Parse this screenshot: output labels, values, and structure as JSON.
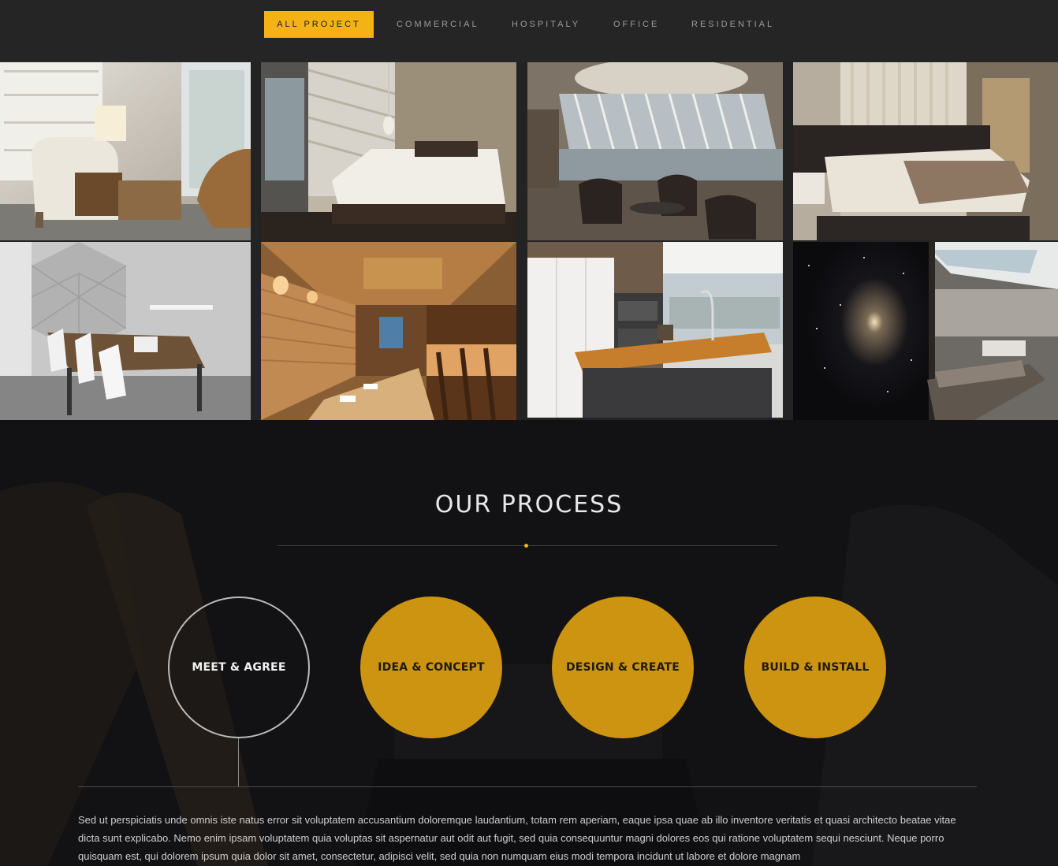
{
  "filters": {
    "items": [
      {
        "label": "ALL PROJECT",
        "active": true
      },
      {
        "label": "COMMERCIAL",
        "active": false
      },
      {
        "label": "HOSPITALY",
        "active": false
      },
      {
        "label": "OFFICE",
        "active": false
      },
      {
        "label": "RESIDENTIAL",
        "active": false
      }
    ]
  },
  "gallery": {
    "images": [
      "living-room-chairs-image",
      "bedroom-pendant-image",
      "lounge-panoramic-window-image",
      "modern-bedroom-image",
      "meeting-room-image",
      "restaurant-bar-image",
      "kitchen-island-image",
      "galaxy-wall-lounge-image"
    ]
  },
  "process": {
    "title": "OUR PROCESS",
    "steps": [
      {
        "label": "MEET & AGREE",
        "style": "outline"
      },
      {
        "label": "IDEA & CONCEPT",
        "style": "gold"
      },
      {
        "label": "DESIGN & CREATE",
        "style": "gold"
      },
      {
        "label": "BUILD & INSTALL",
        "style": "gold"
      }
    ],
    "description": "Sed ut perspiciatis unde omnis iste natus error sit voluptatem accusantium doloremque laudantium, totam rem aperiam, eaque ipsa quae ab illo inventore veritatis et quasi architecto beatae vitae dicta sunt explicabo. Nemo enim ipsam voluptatem quia voluptas sit aspernatur aut odit aut fugit, sed quia consequuntur magni dolores eos qui ratione voluptatem sequi nesciunt. Neque porro quisquam est, qui dolorem ipsum quia dolor sit amet, consectetur, adipisci velit, sed quia non numquam eius modi tempora incidunt ut labore et dolore magnam"
  },
  "colors": {
    "accent": "#f4b214",
    "step_gold": "#cc9410",
    "page_bg": "#232323",
    "section_bg": "#121214"
  }
}
